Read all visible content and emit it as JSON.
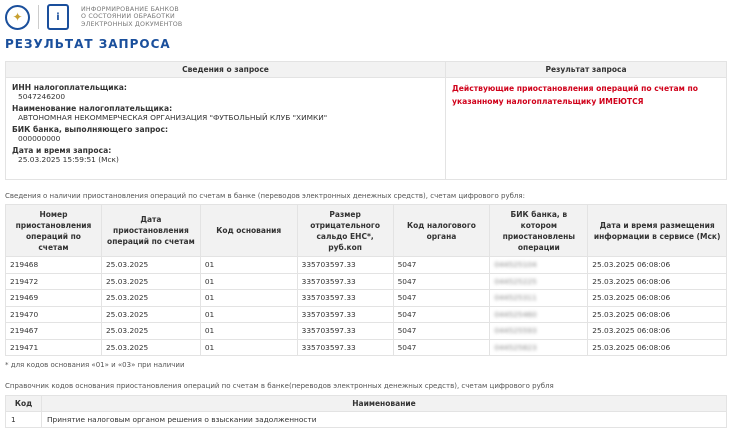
{
  "header": {
    "brand_lines": [
      "ИНФОРМИРОВАНИЕ БАНКОВ",
      "О СОСТОЯНИИ ОБРАБОТКИ",
      "ЭЛЕКТРОННЫХ ДОКУМЕНТОВ"
    ],
    "title": "РЕЗУЛЬТАТ ЗАПРОСА"
  },
  "request": {
    "col1": "Сведения о запросе",
    "col2": "Результат запроса",
    "fields": [
      {
        "label": "ИНН налогоплательщика:",
        "value": "5047246200"
      },
      {
        "label": "Наименование налогоплательщика:",
        "value": "АВТОНОМНАЯ НЕКОММЕРЧЕСКАЯ ОРГАНИЗАЦИЯ \"ФУТБОЛЬНЫЙ КЛУБ \"ХИМКИ\""
      },
      {
        "label": "БИК банка, выполняющего запрос:",
        "value": "000000000"
      },
      {
        "label": "Дата и время запроса:",
        "value": "25.03.2025 15:59:51 (Мск)"
      }
    ],
    "result": "Действующие приостановления операций по счетам по указанному налогоплательщику ИМЕЮТСЯ"
  },
  "suspensions": {
    "caption": "Сведения о наличии приостановления операций по счетам в банке (переводов электронных денежных средств), счетам цифрового рубля:",
    "columns": [
      "Номер приостановления операций по счетам",
      "Дата приостановления операций по счетам",
      "Код основания",
      "Размер отрицательного сальдо ЕНС*, руб.коп",
      "Код налогового органа",
      "БИК банка, в котором приостановлены операции",
      "Дата и время размещения информации в сервисе (Мск)"
    ],
    "rows": [
      [
        "219468",
        "25.03.2025",
        "01",
        "335703597.33",
        "5047",
        "044525104",
        "25.03.2025 06:08:06"
      ],
      [
        "219472",
        "25.03.2025",
        "01",
        "335703597.33",
        "5047",
        "044525225",
        "25.03.2025 06:08:06"
      ],
      [
        "219469",
        "25.03.2025",
        "01",
        "335703597.33",
        "5047",
        "044525311",
        "25.03.2025 06:08:06"
      ],
      [
        "219470",
        "25.03.2025",
        "01",
        "335703597.33",
        "5047",
        "044525460",
        "25.03.2025 06:08:06"
      ],
      [
        "219467",
        "25.03.2025",
        "01",
        "335703597.33",
        "5047",
        "044525593",
        "25.03.2025 06:08:06"
      ],
      [
        "219471",
        "25.03.2025",
        "01",
        "335703597.33",
        "5047",
        "044525823",
        "25.03.2025 06:08:06"
      ]
    ],
    "footnote": "* для кодов основания «01» и «03» при наличии"
  },
  "codes": {
    "caption": "Справочник кодов основания приостановления операций по счетам в банке(переводов электронных денежных средств), счетам цифрового рубля",
    "col1": "Код",
    "col2": "Наименование",
    "rows": [
      [
        "1",
        "Принятие налоговым органом решения о взыскании задолженности"
      ]
    ]
  }
}
